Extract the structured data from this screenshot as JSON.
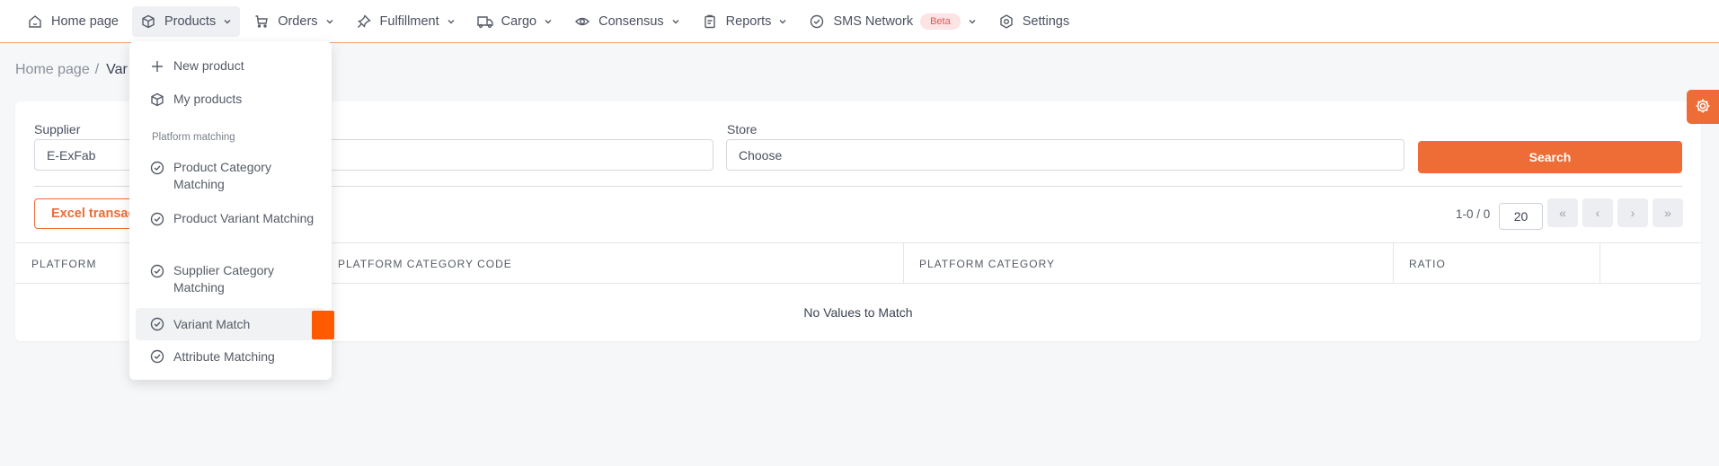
{
  "nav": {
    "home": "Home page",
    "products": "Products",
    "orders": "Orders",
    "fulfillment": "Fulfillment",
    "cargo": "Cargo",
    "consensus": "Consensus",
    "reports": "Reports",
    "sms_network": "SMS Network",
    "beta": "Beta",
    "settings": "Settings"
  },
  "breadcrumb": {
    "home": "Home page",
    "separator": "/",
    "current": "Var"
  },
  "filters": {
    "supplier_label": "Supplier",
    "supplier_value": "E-ExFab",
    "store_label": "Store",
    "store_value": "Choose",
    "search_button": "Search"
  },
  "toolbar": {
    "excel_button": "Excel transac",
    "pager_text": "1-0 / 0",
    "page_size": "20",
    "first": "«",
    "prev": "‹",
    "next": "›",
    "last": "»"
  },
  "table": {
    "headers": [
      "PLATFORM",
      "PLATFORM CATEGORY CODE",
      "PLATFORM CATEGORY",
      "RATIO"
    ],
    "empty_text": "No Values to Match"
  },
  "dropdown": {
    "new_product": "New product",
    "my_products": "My products",
    "section": "Platform matching",
    "items": [
      "Product Category Matching",
      "Product Variant Matching",
      "Supplier Category Matching",
      "Variant Match",
      "Attribute Matching"
    ]
  },
  "colors": {
    "accent": "#ee6c35",
    "active_marker": "#ff5a00"
  }
}
